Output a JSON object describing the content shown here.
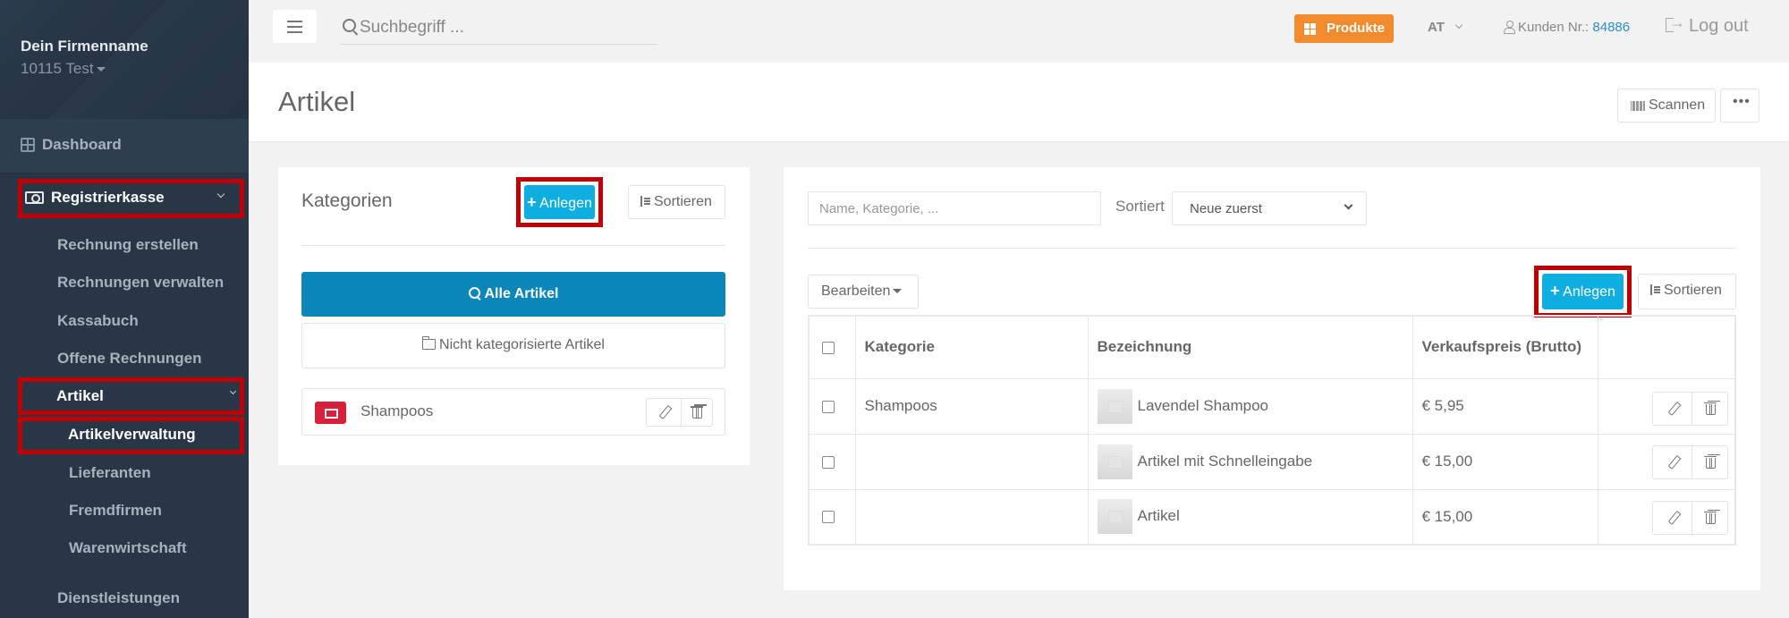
{
  "sidebar": {
    "company": "Dein Firmenname",
    "account": "10115 Test",
    "items": [
      {
        "label": "Dashboard",
        "icon": "grid-icon"
      },
      {
        "label": "Registrierkasse",
        "icon": "money-icon",
        "expanded": true,
        "highlighted": true
      },
      {
        "label": "Rechnung erstellen"
      },
      {
        "label": "Rechnungen verwalten"
      },
      {
        "label": "Kassabuch"
      },
      {
        "label": "Offene Rechnungen"
      },
      {
        "label": "Artikel",
        "expanded": true,
        "highlighted": true
      },
      {
        "label": "Artikelverwaltung",
        "active": true,
        "highlighted": true
      },
      {
        "label": "Lieferanten"
      },
      {
        "label": "Fremdfirmen"
      },
      {
        "label": "Warenwirtschaft"
      },
      {
        "label": "Dienstleistungen"
      }
    ]
  },
  "topbar": {
    "search_placeholder": "Suchbegriff ...",
    "produkte_label": "Produkte",
    "language": "AT",
    "kunden_label": "Kunden Nr.:",
    "kunden_nr": "84886",
    "logout_label": "Log out",
    "colors": {
      "produkte": "#f28a2e",
      "link": "#2d8ccd"
    }
  },
  "page": {
    "title": "Artikel",
    "scan_label": "Scannen",
    "more_label": "•••"
  },
  "categories": {
    "title": "Kategorien",
    "add_label": "Anlegen",
    "sort_label": "Sortieren",
    "all_label": "Alle Artikel",
    "uncategorized_label": "Nicht kategorisierte Artikel",
    "items": [
      {
        "name": "Shampoos",
        "color": "#d9203a"
      }
    ]
  },
  "articles": {
    "filter_placeholder": "Name, Kategorie, ...",
    "sort_prefix": "Sortiert",
    "sort_value": "Neue zuerst",
    "edit_label": "Bearbeiten",
    "add_label": "Anlegen",
    "sort_label": "Sortieren",
    "columns": [
      "Kategorie",
      "Bezeichnung",
      "Verkaufspreis (Brutto)"
    ],
    "rows": [
      {
        "kategorie": "Shampoos",
        "bezeichnung": "Lavendel Shampoo",
        "preis": "€ 5,95"
      },
      {
        "kategorie": "",
        "bezeichnung": "Artikel mit Schnelleingabe",
        "preis": "€ 15,00"
      },
      {
        "kategorie": "",
        "bezeichnung": "Artikel",
        "preis": "€ 15,00"
      }
    ]
  },
  "accent_colors": {
    "primary": "#0eaee0",
    "primary_dark": "#0a86b8",
    "highlight_box": "#c00000",
    "sidebar": "#283646"
  }
}
